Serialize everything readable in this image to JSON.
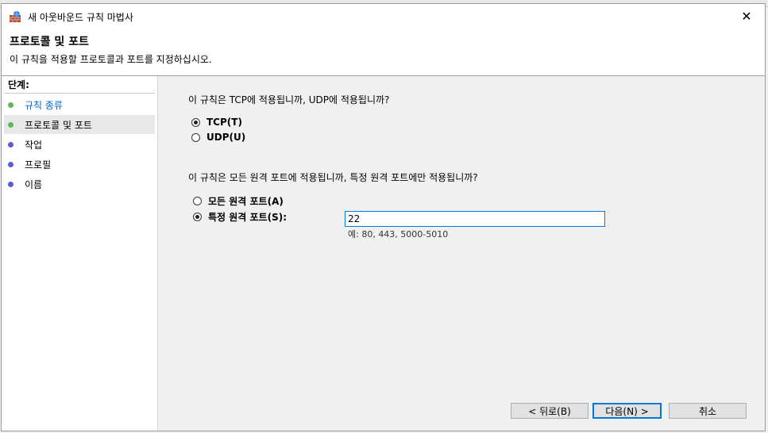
{
  "window": {
    "title": "새 아웃바운드 규칙 마법사",
    "close_glyph": "✕"
  },
  "header": {
    "title": "프로토콜 및 포트",
    "description": "이 규칙을 적용할 프로토콜과 포트를 지정하십시오."
  },
  "steps": {
    "label": "단계:",
    "items": [
      {
        "label": "규칙 종류",
        "state": "done",
        "color": "#5cb85c"
      },
      {
        "label": "프로토콜 및 포트",
        "state": "current",
        "color": "#5cb85c"
      },
      {
        "label": "작업",
        "state": "pending",
        "color": "#5b5bd6"
      },
      {
        "label": "프로필",
        "state": "pending",
        "color": "#5b5bd6"
      },
      {
        "label": "이름",
        "state": "pending",
        "color": "#5b5bd6"
      }
    ]
  },
  "protocol": {
    "question": "이 규칙은 TCP에 적용됩니까, UDP에 적용됩니까?",
    "options": [
      {
        "label": "TCP(T)",
        "checked": true
      },
      {
        "label": "UDP(U)",
        "checked": false
      }
    ]
  },
  "ports": {
    "question": "이 규칙은 모든 원격 포트에 적용됩니까, 특정 원격 포트에만 적용됩니까?",
    "options": [
      {
        "label": "모든 원격 포트(A)",
        "checked": false
      },
      {
        "label": "특정 원격 포트(S):",
        "checked": true
      }
    ],
    "value": "22",
    "hint": "예: 80, 443, 5000-5010"
  },
  "buttons": {
    "back": "< 뒤로(B)",
    "next": "다음(N) >",
    "cancel": "취소"
  }
}
